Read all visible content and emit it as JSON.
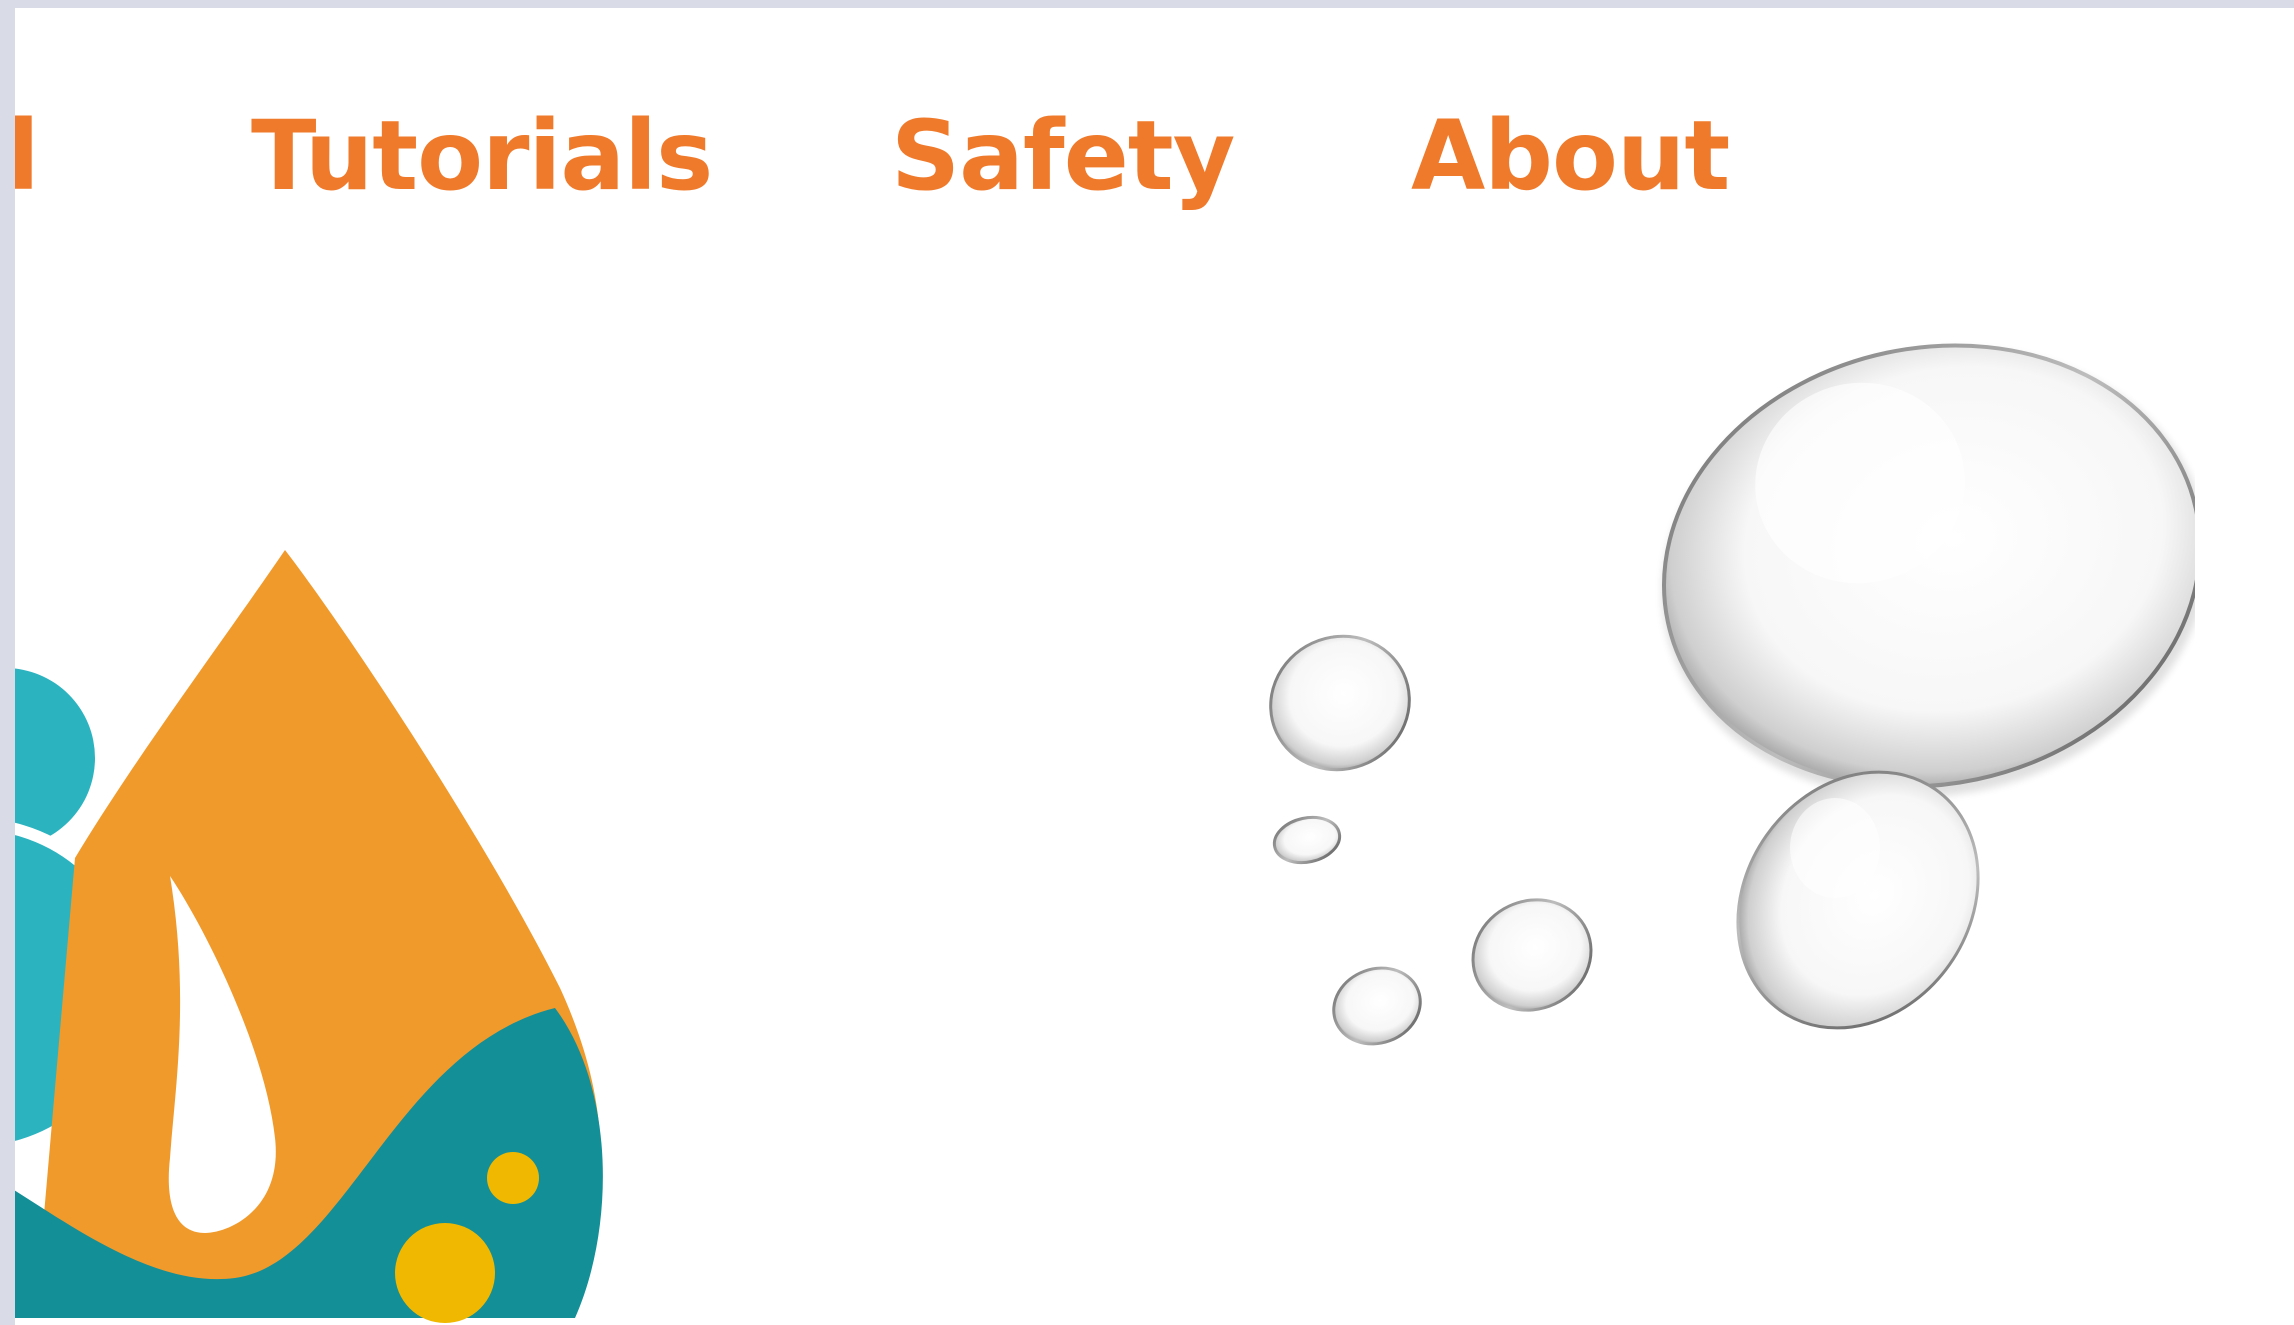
{
  "nav": {
    "items": [
      {
        "id": "partial",
        "label": "d"
      },
      {
        "id": "tutorials",
        "label": "Tutorials"
      },
      {
        "id": "safety",
        "label": "Safety"
      },
      {
        "id": "about",
        "label": "About"
      }
    ]
  },
  "colors": {
    "nav_text": "#f07a2b",
    "logo_orange": "#f09a2c",
    "logo_teal": "#138f97",
    "logo_cyan": "#2bb3c0",
    "logo_yellow": "#f0b800",
    "window_frame": "#d9dbe6"
  },
  "icons": {
    "logo": "water-drop-logo",
    "decoration": "water-droplets-illustration"
  }
}
